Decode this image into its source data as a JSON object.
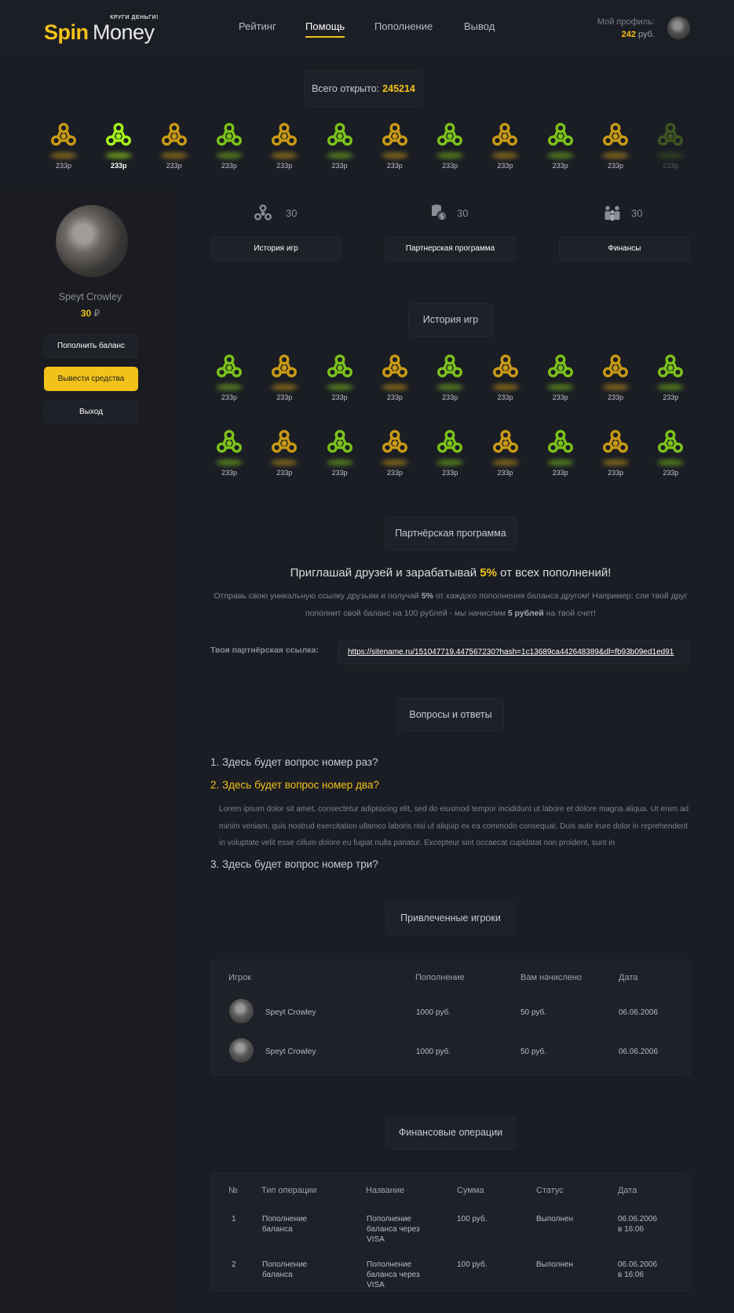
{
  "header": {
    "logo_spin": "Spin",
    "logo_money": "Money",
    "logo_tag": "КРУГИ ДЕНЬГИ!",
    "nav": [
      "Рейтинг",
      "Помощь",
      "Пополнение",
      "Вывод"
    ],
    "active_nav": "Помощь",
    "profile_label": "Мой профиль:",
    "profile_balance_value": "242",
    "profile_balance_unit": "руб."
  },
  "counter": {
    "label": "Всего открыто:",
    "value": "245214"
  },
  "top_spinners": [
    {
      "label": "233р",
      "color": "orange"
    },
    {
      "label": "233р",
      "color": "bright-green"
    },
    {
      "label": "233р",
      "color": "orange"
    },
    {
      "label": "233р",
      "color": "green"
    },
    {
      "label": "233р",
      "color": "orange"
    },
    {
      "label": "233р",
      "color": "green"
    },
    {
      "label": "233р",
      "color": "orange"
    },
    {
      "label": "233р",
      "color": "green"
    },
    {
      "label": "233р",
      "color": "orange"
    },
    {
      "label": "233р",
      "color": "green"
    },
    {
      "label": "233р",
      "color": "orange"
    },
    {
      "label": "233р",
      "color": "dim-green"
    }
  ],
  "sidebar": {
    "name": "Speyt Crowley",
    "balance_value": "30",
    "balance_unit": "₽",
    "buttons": {
      "topup": "Пополнить баланс",
      "withdraw": "Вывести средства",
      "logout": "Выход"
    }
  },
  "stats": {
    "games_count": "30",
    "partners_count": "30",
    "finances_count": "30",
    "tabs": [
      "История игр",
      "Партнерская программа",
      "Финансы"
    ]
  },
  "history": {
    "title": "История игр",
    "row1": [
      {
        "label": "233р",
        "color": "green"
      },
      {
        "label": "233р",
        "color": "orange"
      },
      {
        "label": "233р",
        "color": "green"
      },
      {
        "label": "233р",
        "color": "orange"
      },
      {
        "label": "233р",
        "color": "green"
      },
      {
        "label": "233р",
        "color": "orange"
      },
      {
        "label": "233р",
        "color": "green"
      },
      {
        "label": "233р",
        "color": "orange"
      },
      {
        "label": "233р",
        "color": "green"
      }
    ],
    "row2": [
      {
        "label": "233р",
        "color": "green"
      },
      {
        "label": "233р",
        "color": "orange"
      },
      {
        "label": "233р",
        "color": "green"
      },
      {
        "label": "233р",
        "color": "orange"
      },
      {
        "label": "233р",
        "color": "green"
      },
      {
        "label": "233р",
        "color": "orange"
      },
      {
        "label": "233р",
        "color": "green"
      },
      {
        "label": "233р",
        "color": "orange"
      },
      {
        "label": "233р",
        "color": "green"
      }
    ]
  },
  "partner": {
    "title": "Партнёрская программа",
    "invite_pre": "Приглашай друзей и зарабатывай ",
    "invite_pct": "5%",
    "invite_post": " от всех пополнений!",
    "desc_1": "Отправь свою уникальную ссылку друзьям и получай ",
    "desc_pct": "5%",
    "desc_2": " от каждого пополнения баланса другом! Например: сли твой друг пополнит свой баланс на 100 рублей - мы начислим ",
    "desc_amount": "5 рублей",
    "desc_3": " на твой счет!",
    "ref_label": "Твоя партнёрская ссылка:",
    "ref_link": "https://sitename.ru/151047719.447567230?hash=1c13689ca442648389&dl=fb93b09ed1ed91"
  },
  "faq": {
    "title": "Вопросы и ответы",
    "q1": "1. Здесь будет вопрос номер раз?",
    "q2": "2. Здесь будет вопрос номер два?",
    "answer": "Lorem ipsum dolor sit amet, consectetur adipisicing elit, sed do eiusmod tempor incididunt ut labore et dolore magna aliqua. Ut enim ad minim veniam, quis nostrud exercitation ullamco laboris nisi ut aliquip ex ea commodo consequat. Duis aute irure dolor in reprehenderit in voluptate velit esse cillum dolore eu fugiat nulla pariatur. Excepteur sint occaecat cupidatat non proident, sunt in",
    "q3": "3. Здесь будет вопрос номер три?"
  },
  "players": {
    "title": "Привлеченные игроки",
    "headers": [
      "Игрок",
      "Пополнение",
      "Вам начислено",
      "Дата"
    ],
    "rows": [
      {
        "name": "Speyt Crowley",
        "topup": "1000 руб.",
        "credited": "50 руб.",
        "date": "06.06.2006"
      },
      {
        "name": "Speyt Crowley",
        "topup": "1000 руб.",
        "credited": "50 руб.",
        "date": "06.06.2006"
      }
    ]
  },
  "finance": {
    "title": "Финансовые операции",
    "headers": [
      "№",
      "Тип операции",
      "Название",
      "Сумма",
      "Статус",
      "Дата"
    ],
    "rows": [
      {
        "n": "1",
        "type_1": "Пополнение",
        "type_2": "баланса",
        "name_1": "Пополнение",
        "name_2": "баланса через",
        "name_3": "VISA",
        "sum": "100 руб.",
        "status": "Выполнен",
        "date_1": "06.06.2006",
        "date_2": "в 16:06"
      },
      {
        "n": "2",
        "type_1": "Пополнение",
        "type_2": "баланса",
        "name_1": "Пополнение",
        "name_2": "баланса через",
        "name_3": "VISA",
        "sum": "100 руб.",
        "status": "Выполнен",
        "date_1": "06.06.2006",
        "date_2": "в 16:06"
      }
    ]
  },
  "colors": {
    "accent": "#f2c21b",
    "orange": "#c89a16",
    "green": "#7cc21b",
    "bright_green": "#a6f21c"
  }
}
